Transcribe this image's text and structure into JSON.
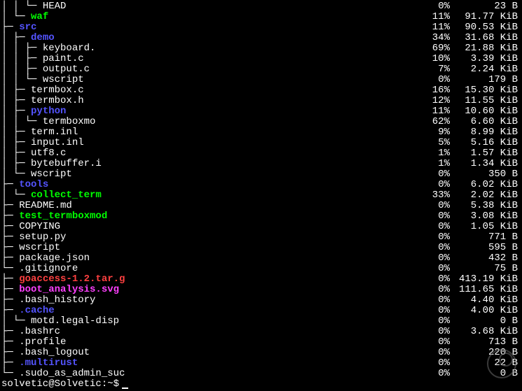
{
  "prompt": "solvetic@Solvetic:~$ ",
  "tree_chars": {
    "pipe": "│",
    "tee": "├─",
    "elbow": "└─",
    "space": "  "
  },
  "rows": [
    {
      "prefix": "│ │ └─ ",
      "name": "HEAD",
      "color": "c-white",
      "pct": "0%",
      "size": "23 B"
    },
    {
      "prefix": "│ └─ ",
      "name": "waf",
      "color": "c-green",
      "pct": "11%",
      "size": "91.77 KiB"
    },
    {
      "prefix": "├─ ",
      "name": "src",
      "color": "c-blue",
      "pct": "11%",
      "size": "90.53 KiB"
    },
    {
      "prefix": "│ ├─ ",
      "name": "demo",
      "color": "c-blue",
      "pct": "34%",
      "size": "31.68 KiB"
    },
    {
      "prefix": "│ │ ├─ ",
      "name": "keyboard.",
      "color": "c-white",
      "pct": "69%",
      "size": "21.88 KiB"
    },
    {
      "prefix": "│ │ ├─ ",
      "name": "paint.c",
      "color": "c-white",
      "pct": "10%",
      "size": "3.39 KiB"
    },
    {
      "prefix": "│ │ ├─ ",
      "name": "output.c",
      "color": "c-white",
      "pct": "7%",
      "size": "2.24 KiB"
    },
    {
      "prefix": "│ │ └─ ",
      "name": "wscript",
      "color": "c-white",
      "pct": "0%",
      "size": "179 B"
    },
    {
      "prefix": "│ ├─ ",
      "name": "termbox.c",
      "color": "c-white",
      "pct": "16%",
      "size": "15.30 KiB"
    },
    {
      "prefix": "│ ├─ ",
      "name": "termbox.h",
      "color": "c-white",
      "pct": "12%",
      "size": "11.55 KiB"
    },
    {
      "prefix": "│ ├─ ",
      "name": "python",
      "color": "c-blue",
      "pct": "11%",
      "size": "10.60 KiB"
    },
    {
      "prefix": "│ │ └─ ",
      "name": "termboxmo",
      "color": "c-white",
      "pct": "62%",
      "size": "6.60 KiB"
    },
    {
      "prefix": "│ ├─ ",
      "name": "term.inl",
      "color": "c-white",
      "pct": "9%",
      "size": "8.99 KiB"
    },
    {
      "prefix": "│ ├─ ",
      "name": "input.inl",
      "color": "c-white",
      "pct": "5%",
      "size": "5.16 KiB"
    },
    {
      "prefix": "│ ├─ ",
      "name": "utf8.c",
      "color": "c-white",
      "pct": "1%",
      "size": "1.57 KiB"
    },
    {
      "prefix": "│ ├─ ",
      "name": "bytebuffer.i",
      "color": "c-white",
      "pct": "1%",
      "size": "1.34 KiB"
    },
    {
      "prefix": "│ └─ ",
      "name": "wscript",
      "color": "c-white",
      "pct": "0%",
      "size": "350 B"
    },
    {
      "prefix": "├─ ",
      "name": "tools",
      "color": "c-blue",
      "pct": "0%",
      "size": "6.02 KiB"
    },
    {
      "prefix": "│ └─ ",
      "name": "collect_term",
      "color": "c-green",
      "pct": "33%",
      "size": "2.02 KiB"
    },
    {
      "prefix": "├─ ",
      "name": "README.md",
      "color": "c-white",
      "pct": "0%",
      "size": "5.38 KiB"
    },
    {
      "prefix": "├─ ",
      "name": "test_termboxmod",
      "color": "c-green",
      "pct": "0%",
      "size": "3.08 KiB"
    },
    {
      "prefix": "├─ ",
      "name": "COPYING",
      "color": "c-white",
      "pct": "0%",
      "size": "1.05 KiB"
    },
    {
      "prefix": "├─ ",
      "name": "setup.py",
      "color": "c-white",
      "pct": "0%",
      "size": "771 B"
    },
    {
      "prefix": "├─ ",
      "name": "wscript",
      "color": "c-white",
      "pct": "0%",
      "size": "595 B"
    },
    {
      "prefix": "├─ ",
      "name": "package.json",
      "color": "c-white",
      "pct": "0%",
      "size": "432 B"
    },
    {
      "prefix": "└─ ",
      "name": ".gitignore",
      "color": "c-white",
      "pct": "0%",
      "size": "75 B"
    },
    {
      "prefix": "├─ ",
      "name": "goaccess-1.2.tar.g",
      "color": "c-red",
      "pct": "0%",
      "size": "413.19 KiB"
    },
    {
      "prefix": "├─ ",
      "name": "boot_analysis.svg",
      "color": "c-mag",
      "pct": "0%",
      "size": "111.65 KiB"
    },
    {
      "prefix": "├─ ",
      "name": ".bash_history",
      "color": "c-white",
      "pct": "0%",
      "size": "4.40 KiB"
    },
    {
      "prefix": "├─ ",
      "name": ".cache",
      "color": "c-blue",
      "pct": "0%",
      "size": "4.00 KiB"
    },
    {
      "prefix": "│ └─ ",
      "name": "motd.legal-disp",
      "color": "c-white",
      "pct": "0%",
      "size": "0 B"
    },
    {
      "prefix": "├─ ",
      "name": ".bashrc",
      "color": "c-white",
      "pct": "0%",
      "size": "3.68 KiB"
    },
    {
      "prefix": "├─ ",
      "name": ".profile",
      "color": "c-white",
      "pct": "0%",
      "size": "713 B"
    },
    {
      "prefix": "├─ ",
      "name": ".bash_logout",
      "color": "c-white",
      "pct": "0%",
      "size": "220 B"
    },
    {
      "prefix": "├─ ",
      "name": ".multirust",
      "color": "c-blue",
      "pct": "0%",
      "size": "22 B"
    },
    {
      "prefix": "└─ ",
      "name": ".sudo_as_admin_suc",
      "color": "c-white",
      "pct": "0%",
      "size": "0 B"
    }
  ]
}
